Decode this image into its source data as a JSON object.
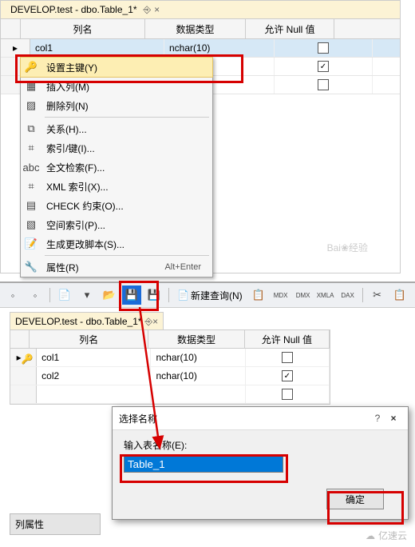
{
  "top_tab": "DEVELOP.test - dbo.Table_1*",
  "headers": {
    "name": "列名",
    "type": "数据类型",
    "null": "允许 Null 值"
  },
  "rows_top": [
    {
      "name": "col1",
      "type": "nchar(10)",
      "checked": false
    }
  ],
  "rows_extra": [
    {
      "name": "",
      "type": "",
      "checked": true
    },
    {
      "name": "",
      "type": "",
      "checked": false
    }
  ],
  "context_menu": [
    {
      "icon": "key-icon",
      "label": "设置主键(Y)",
      "hl": true
    },
    {
      "icon": "insert-icon",
      "label": "插入列(M)"
    },
    {
      "icon": "delete-icon",
      "label": "删除列(N)"
    },
    {
      "sep": true
    },
    {
      "icon": "relation-icon",
      "label": "关系(H)..."
    },
    {
      "icon": "index-icon",
      "label": "索引/键(I)..."
    },
    {
      "icon": "fulltext-icon",
      "label": "全文检索(F)..."
    },
    {
      "icon": "xml-icon",
      "label": "XML 索引(X)..."
    },
    {
      "icon": "check-icon",
      "label": "CHECK 约束(O)..."
    },
    {
      "icon": "spatial-icon",
      "label": "空间索引(P)..."
    },
    {
      "icon": "script-icon",
      "label": "生成更改脚本(S)..."
    },
    {
      "sep": true
    },
    {
      "icon": "wrench-icon",
      "label": "属性(R)",
      "shortcut": "Alt+Enter"
    }
  ],
  "toolbar": {
    "new_query": "新建查询(N)",
    "icons": [
      "MDX",
      "DMX",
      "XMLA",
      "DAX"
    ]
  },
  "bottom_tab": "DEVELOP.test - dbo.Table_1*",
  "rows_bottom": [
    {
      "name": "col1",
      "type": "nchar(10)",
      "checked": false,
      "key": true
    },
    {
      "name": "col2",
      "type": "nchar(10)",
      "checked": true
    },
    {
      "name": "",
      "type": "",
      "checked": false
    }
  ],
  "dialog": {
    "title": "选择名称",
    "label": "输入表名称(E):",
    "value": "Table_1",
    "ok": "确定"
  },
  "col_prop_label": "列属性",
  "watermark1": "Bai❀经验",
  "watermark2": "亿速云"
}
